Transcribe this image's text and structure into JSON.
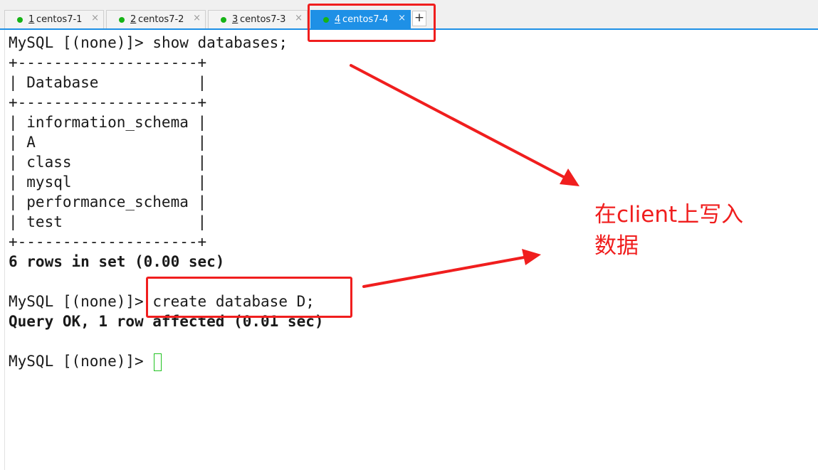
{
  "tabs": [
    {
      "num": "1",
      "label": "centos7-1",
      "close": "×",
      "active": false
    },
    {
      "num": "2",
      "label": "centos7-2",
      "close": "×",
      "active": false
    },
    {
      "num": "3",
      "label": "centos7-3",
      "close": "×",
      "active": false
    },
    {
      "num": "4",
      "label": "centos7-4",
      "close": "×",
      "active": true
    }
  ],
  "new_tab_label": "+",
  "terminal": {
    "prompt": "MySQL [(none)]>",
    "command1": "show databases;",
    "table_border": "+--------------------+",
    "table_header": "| Database           |",
    "rows": [
      "| information_schema |",
      "| A                  |",
      "| class              |",
      "| mysql              |",
      "| performance_schema |",
      "| test               |"
    ],
    "result1": "6 rows in set (0.00 sec)",
    "command2": "create database D;",
    "result2": "Query OK, 1 row affected (0.01 sec)"
  },
  "annotation": {
    "line1": "在client上写入",
    "line2": "数据",
    "color": "#f01e1e"
  },
  "colors": {
    "accent": "#1e90e6",
    "status_dot": "#16b316",
    "cursor": "#22c322"
  }
}
